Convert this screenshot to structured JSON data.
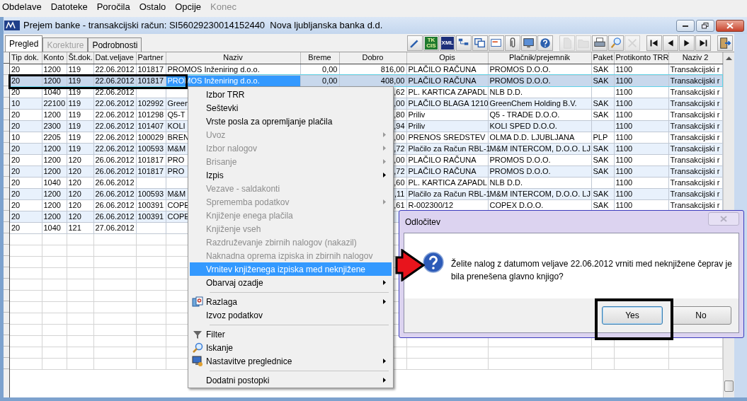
{
  "menu_bar": [
    {
      "label": "Obdelave",
      "disabled": false
    },
    {
      "label": "Datoteke",
      "disabled": false
    },
    {
      "label": "Poročila",
      "disabled": false
    },
    {
      "label": "Ostalo",
      "disabled": false
    },
    {
      "label": "Opcije",
      "disabled": false
    },
    {
      "label": "Konec",
      "disabled": true
    }
  ],
  "window": {
    "title": "Prejem banke - transakcijski račun: SI56029230014152440  Nova ljubljanska banka d.d."
  },
  "tabs": [
    {
      "label": "Pregled",
      "selected": true,
      "disabled": false
    },
    {
      "label": "Korekture",
      "selected": false,
      "disabled": true
    },
    {
      "label": "Podrobnosti",
      "selected": false,
      "disabled": false
    }
  ],
  "toolbar": [
    {
      "disabled": false
    },
    {
      "disabled": false,
      "lines": [
        "TK",
        "CIS"
      ]
    },
    {
      "disabled": false,
      "lines": [
        "XML"
      ]
    },
    {
      "disabled": false
    },
    {
      "disabled": false
    },
    {
      "disabled": false
    },
    {
      "disabled": false
    },
    {
      "disabled": false
    },
    {
      "disabled": false
    },
    {
      "disabled": true
    },
    {
      "disabled": true
    },
    {
      "disabled": false
    },
    {
      "disabled": false
    },
    {
      "disabled": true
    },
    {
      "disabled": false
    },
    {
      "disabled": false
    },
    {
      "disabled": false
    },
    {
      "disabled": false
    },
    {
      "disabled": false
    }
  ],
  "table": {
    "columns": [
      "Tip dok.",
      "Konto",
      "Št.dok.",
      "Dat.veljave",
      "Partner",
      "Naziv",
      "Breme",
      "Dobro",
      "Opis",
      "Plačnik/prejemnik",
      "Paket",
      "Protikonto TRR",
      "Naziv 2"
    ],
    "rows": [
      {
        "selected": false,
        "cells": [
          "20",
          "1200",
          "119",
          "22.06.2012",
          "101817",
          "PROMOS Inženiring d.o.o.",
          "0,00",
          "816,00",
          "PLAČILO RAČUNA",
          "PROMOS D.O.O.",
          "SAK",
          "1100",
          "Transakcijski r"
        ]
      },
      {
        "selected": true,
        "cells": [
          "20",
          "1200",
          "119",
          "22.06.2012",
          "101817",
          "PROMOS Inženiring d.o.o.",
          "0,00",
          "408,00",
          "PLAČILO RAČUNA",
          "PROMOS D.O.O.",
          "SAK",
          "1100",
          "Transakcijski r"
        ]
      },
      {
        "selected": false,
        "cells": [
          "20",
          "1040",
          "119",
          "22.06.2012",
          null,
          null,
          null,
          ",62",
          "PL. KARTICA ZAPADL",
          "NLB D.D.",
          null,
          "1100",
          "Transakcijski r"
        ]
      },
      {
        "selected": false,
        "cells": [
          "10",
          "22100",
          "119",
          "22.06.2012",
          "102992",
          "Green",
          null,
          ",00",
          "PLAČILO BLAGA 1210",
          "GreenChem Holding B.V.",
          "SAK",
          "1100",
          "Transakcijski r"
        ]
      },
      {
        "selected": false,
        "cells": [
          "20",
          "1200",
          "119",
          "22.06.2012",
          "101298",
          "Q5-T",
          null,
          ",80",
          "Priliv",
          "Q5 - TRADE D.O.O.",
          "SAK",
          "1100",
          "Transakcijski r"
        ]
      },
      {
        "selected": false,
        "cells": [
          "20",
          "2300",
          "119",
          "22.06.2012",
          "101407",
          "KOLI",
          null,
          ",94",
          "Priliv",
          "KOLI SPED D.O.O.",
          null,
          "1100",
          "Transakcijski r"
        ]
      },
      {
        "selected": false,
        "cells": [
          "10",
          "2205",
          "119",
          "22.06.2012",
          "100029",
          "BREN",
          null,
          ",00",
          "PRENOS SREDSTEV",
          "OLMA  D.D. LJUBLJANA",
          "PLP",
          "1100",
          "Transakcijski r"
        ]
      },
      {
        "selected": false,
        "cells": [
          "20",
          "1200",
          "119",
          "22.06.2012",
          "100593",
          "M&M",
          null,
          ",72",
          "Plačilo za Račun RBL-1",
          "M&M INTERCOM, D.O.O. LJ",
          "SAK",
          "1100",
          "Transakcijski r"
        ]
      },
      {
        "selected": false,
        "cells": [
          "20",
          "1200",
          "120",
          "26.06.2012",
          "101817",
          "PRO",
          null,
          ",00",
          "PLAČILO RAČUNA",
          "PROMOS D.O.O.",
          "SAK",
          "1100",
          "Transakcijski r"
        ]
      },
      {
        "selected": false,
        "cells": [
          "20",
          "1200",
          "120",
          "26.06.2012",
          "101817",
          "PRO",
          null,
          ",72",
          "PLAČILO RAČUNA",
          "PROMOS D.O.O.",
          "SAK",
          "1100",
          "Transakcijski r"
        ]
      },
      {
        "selected": false,
        "cells": [
          "20",
          "1040",
          "120",
          "26.06.2012",
          null,
          null,
          null,
          ",60",
          "PL. KARTICA ZAPADL",
          "NLB D.D.",
          null,
          "1100",
          "Transakcijski r"
        ]
      },
      {
        "selected": false,
        "cells": [
          "20",
          "1200",
          "120",
          "26.06.2012",
          "100593",
          "M&M",
          null,
          ",11",
          "Plačilo za Račun RBL-1",
          "M&M INTERCOM, D.O.O. LJ",
          "SAK",
          "1100",
          "Transakcijski r"
        ]
      },
      {
        "selected": false,
        "cells": [
          "20",
          "1200",
          "120",
          "26.06.2012",
          "100391",
          "COPE",
          null,
          ",61",
          "R-002300/12",
          "COPEX D.O.O.",
          "SAK",
          "1100",
          "Transakcijski r"
        ]
      },
      {
        "selected": false,
        "cells": [
          "20",
          "1200",
          "120",
          "26.06.2012",
          "100391",
          "COPE",
          null,
          null,
          null,
          null,
          null,
          null,
          null
        ]
      },
      {
        "selected": false,
        "cells": [
          "20",
          "1040",
          "121",
          "27.06.2012",
          null,
          null,
          null,
          null,
          null,
          null,
          null,
          null,
          null
        ]
      }
    ]
  },
  "context_menu": {
    "items": [
      {
        "kind": "item",
        "label": "Izbor TRR",
        "disabled": false,
        "submenu": false,
        "selected": false
      },
      {
        "kind": "item",
        "label": "Seštevki",
        "disabled": false,
        "submenu": false,
        "selected": false
      },
      {
        "kind": "item",
        "label": "Vrste posla za opremljanje plačila",
        "disabled": false,
        "submenu": false,
        "selected": false
      },
      {
        "kind": "item",
        "label": "Uvoz",
        "disabled": true,
        "submenu": true,
        "selected": false
      },
      {
        "kind": "item",
        "label": "Izbor nalogov",
        "disabled": true,
        "submenu": true,
        "selected": false
      },
      {
        "kind": "item",
        "label": "Brisanje",
        "disabled": true,
        "submenu": true,
        "selected": false
      },
      {
        "kind": "item",
        "label": "Izpis",
        "disabled": false,
        "submenu": true,
        "selected": false
      },
      {
        "kind": "item",
        "label": "Vezave - saldakonti",
        "disabled": true,
        "submenu": false,
        "selected": false
      },
      {
        "kind": "item",
        "label": "Sprememba podatkov",
        "disabled": true,
        "submenu": true,
        "selected": false
      },
      {
        "kind": "item",
        "label": "Knjiženje enega plačila",
        "disabled": true,
        "submenu": false,
        "selected": false
      },
      {
        "kind": "item",
        "label": "Knjiženje vseh",
        "disabled": true,
        "submenu": false,
        "selected": false
      },
      {
        "kind": "item",
        "label": "Razdruževanje zbirnih nalogov (nakazil)",
        "disabled": true,
        "submenu": false,
        "selected": false
      },
      {
        "kind": "item",
        "label": "Naknadna oprema izpiska in zbirnih nalogov",
        "disabled": true,
        "submenu": false,
        "selected": false
      },
      {
        "kind": "item",
        "label": "Vrnitev knjiženega izpiska med neknjižene",
        "disabled": false,
        "submenu": false,
        "selected": true
      },
      {
        "kind": "item",
        "label": "Obarvaj ozadje",
        "disabled": false,
        "submenu": true,
        "selected": false
      },
      {
        "kind": "separator"
      },
      {
        "kind": "item",
        "label": "Razlaga",
        "disabled": false,
        "submenu": true,
        "selected": false
      },
      {
        "kind": "item",
        "label": "Izvoz podatkov",
        "disabled": false,
        "submenu": false,
        "selected": false
      },
      {
        "kind": "separator"
      },
      {
        "kind": "item",
        "label": "Filter",
        "disabled": false,
        "submenu": false,
        "selected": false
      },
      {
        "kind": "item",
        "label": "Iskanje",
        "disabled": false,
        "submenu": false,
        "selected": false
      },
      {
        "kind": "item",
        "label": "Nastavitve preglednice",
        "disabled": false,
        "submenu": true,
        "selected": false
      },
      {
        "kind": "separator"
      },
      {
        "kind": "item",
        "label": "Dodatni postopki",
        "disabled": false,
        "submenu": true,
        "selected": false
      }
    ]
  },
  "dialog": {
    "title": "Odločitev",
    "close_disabled": true,
    "message": "Želite nalog z datumom veljave 22.06.2012 vrniti med neknjižene čeprav je bila prenešena glavno knjigo?",
    "buttons": [
      {
        "label": "Yes",
        "selected": true
      },
      {
        "label": "No",
        "selected": false
      }
    ]
  }
}
